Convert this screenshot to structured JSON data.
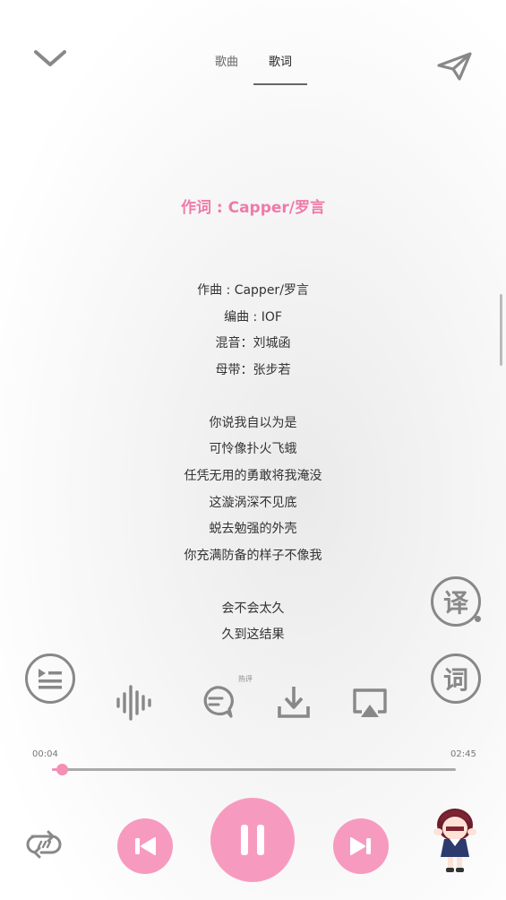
{
  "header": {
    "tabs": [
      {
        "label": "歌曲",
        "active": false
      },
      {
        "label": "歌词",
        "active": true
      }
    ],
    "collapse_icon": "chevron-down-icon",
    "share_icon": "paper-plane-icon"
  },
  "lyrics": {
    "title": "作词 : Capper/罗言",
    "lines": [
      "作曲 : Capper/罗言",
      "编曲 : IOF",
      "混音：刘城函",
      "母带：张步若",
      "你说我自以为是",
      "可怜像扑火飞蛾",
      "任凭无用的勇敢将我淹没",
      "这漩涡深不见底",
      "蜕去勉强的外壳",
      "你充满防备的样子不像我",
      "会不会太久",
      "久到这结果"
    ]
  },
  "side": {
    "translate_label": "译",
    "lyric_label": "词"
  },
  "toolbar": {
    "hot_comment_label": "热评",
    "icons": [
      "playlist-icon",
      "sound-wave-icon",
      "comment-icon",
      "download-icon",
      "cast-icon"
    ]
  },
  "progress": {
    "current": "00:04",
    "total": "02:45",
    "fraction": 0.025
  },
  "colors": {
    "accent": "#f79ac0",
    "title_pink": "#f07aa9",
    "icon_gray": "#888888"
  }
}
